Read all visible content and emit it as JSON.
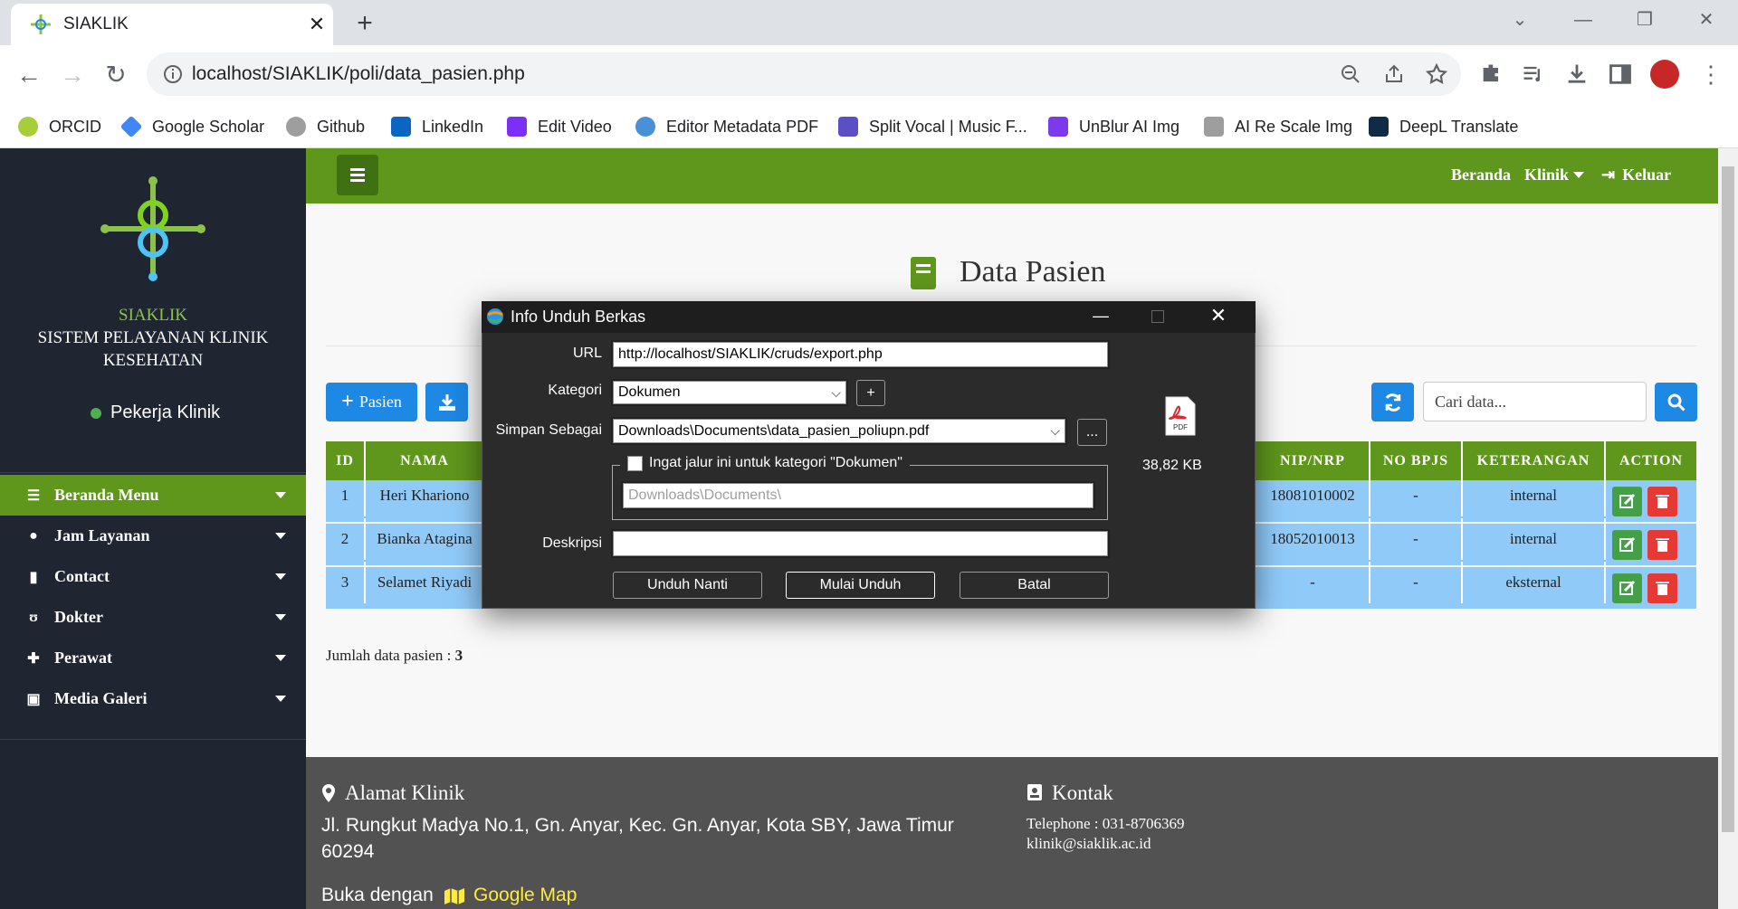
{
  "browser": {
    "tab_title": "SIAKLIK",
    "url": "localhost/SIAKLIK/poli/data_pasien.php",
    "bookmarks": [
      "ORCID",
      "Google Scholar",
      "Github",
      "LinkedIn",
      "Edit Video",
      "Editor Metadata PDF",
      "Split Vocal | Music F...",
      "UnBlur AI Img",
      "AI Re Scale Img",
      "DeepL Translate"
    ]
  },
  "sidebar": {
    "app_name": "SIAKLIK",
    "full_name_line1": "SISTEM PELAYANAN KLINIK",
    "full_name_line2": "KESEHATAN",
    "status": "Pekerja Klinik",
    "menu": [
      "Beranda Menu",
      "Jam Layanan",
      "Contact",
      "Dokter",
      "Perawat",
      "Media Galeri"
    ]
  },
  "topnav": {
    "beranda": "Beranda",
    "klinik": "Klinik",
    "keluar": "Keluar"
  },
  "main": {
    "title": "Data Pasien",
    "add_button": "Pasien",
    "search_placeholder": "Cari data...",
    "columns": [
      "ID",
      "NAMA",
      "NIP/NRP",
      "NO BPJS",
      "KETERANGAN",
      "ACTION"
    ],
    "rows": [
      {
        "id": "1",
        "nama": "Heri Khariono",
        "nip": "18081010002",
        "bpjs": "-",
        "ket": "internal"
      },
      {
        "id": "2",
        "nama": "Bianka Atagina",
        "nip": "18052010013",
        "bpjs": "-",
        "ket": "internal"
      },
      {
        "id": "3",
        "nama": "Selamet Riyadi",
        "nip": "-",
        "bpjs": "-",
        "ket": "eksternal"
      }
    ],
    "count_label": "Jumlah data pasien : ",
    "count": "3"
  },
  "footer": {
    "alamat_title": "Alamat Klinik",
    "address_line1": "Jl. Rungkut Madya No.1, Gn. Anyar, Kec. Gn. Anyar, Kota SBY, Jawa Timur",
    "address_line2": "60294",
    "buka": "Buka dengan",
    "map": "Google Map",
    "kontak_title": "Kontak",
    "telephone": "Telephone : 031-8706369",
    "email": "klinik@siaklik.ac.id"
  },
  "dialog": {
    "title": "Info Unduh Berkas",
    "url_label": "URL",
    "url_value": "http://localhost/SIAKLIK/cruds/export.php",
    "kategori_label": "Kategori",
    "kategori_value": "Dokumen",
    "simpan_label": "Simpan Sebagai",
    "simpan_value": "Downloads\\Documents\\data_pasien_poliupn.pdf",
    "browse": "...",
    "plus": "+",
    "ingat_label": "Ingat jalur ini untuk kategori \"Dokumen\"",
    "ingat_path": "Downloads\\Documents\\",
    "deskripsi_label": "Deskripsi",
    "file_size": "38,82  KB",
    "pdf_label": "PDF",
    "btn_nanti": "Unduh Nanti",
    "btn_mulai": "Mulai Unduh",
    "btn_batal": "Batal"
  },
  "colors": {
    "green": "#5f961c",
    "sidebar": "#1f2531",
    "blue": "#1e88e5",
    "row": "#90caf9"
  }
}
